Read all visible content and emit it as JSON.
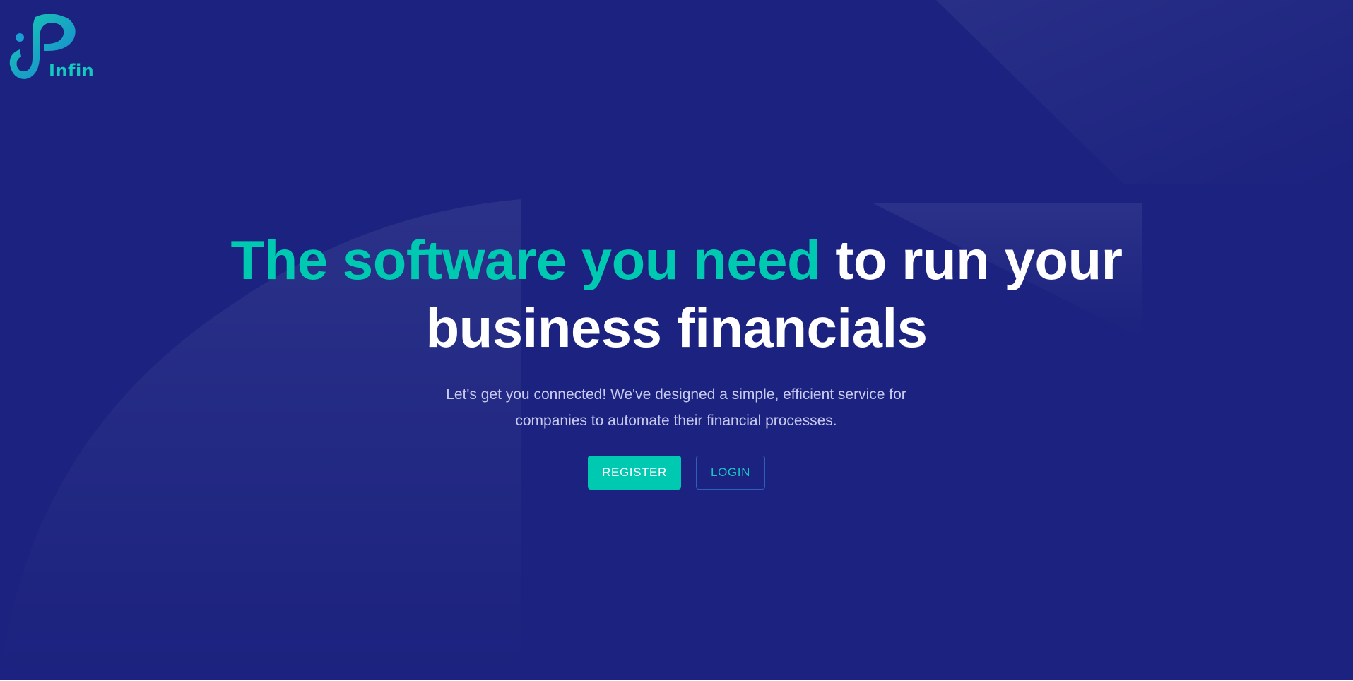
{
  "brand": {
    "name": "Infin",
    "logo_icon": "infin-logo-icon"
  },
  "hero": {
    "headline_accent": "The software you need",
    "headline_rest_line1": " to run your",
    "headline_line2": "business financials",
    "subtext_line1": "Let's get you connected! We've designed a simple, efficient service for",
    "subtext_line2": "companies to automate their financial processes."
  },
  "actions": {
    "register_label": "REGISTER",
    "login_label": "LOGIN"
  },
  "colors": {
    "background": "#1b227f",
    "accent": "#00c9b1",
    "text": "#ffffff",
    "subtext": "#c9cbee",
    "login_border": "#2f5fb8"
  }
}
